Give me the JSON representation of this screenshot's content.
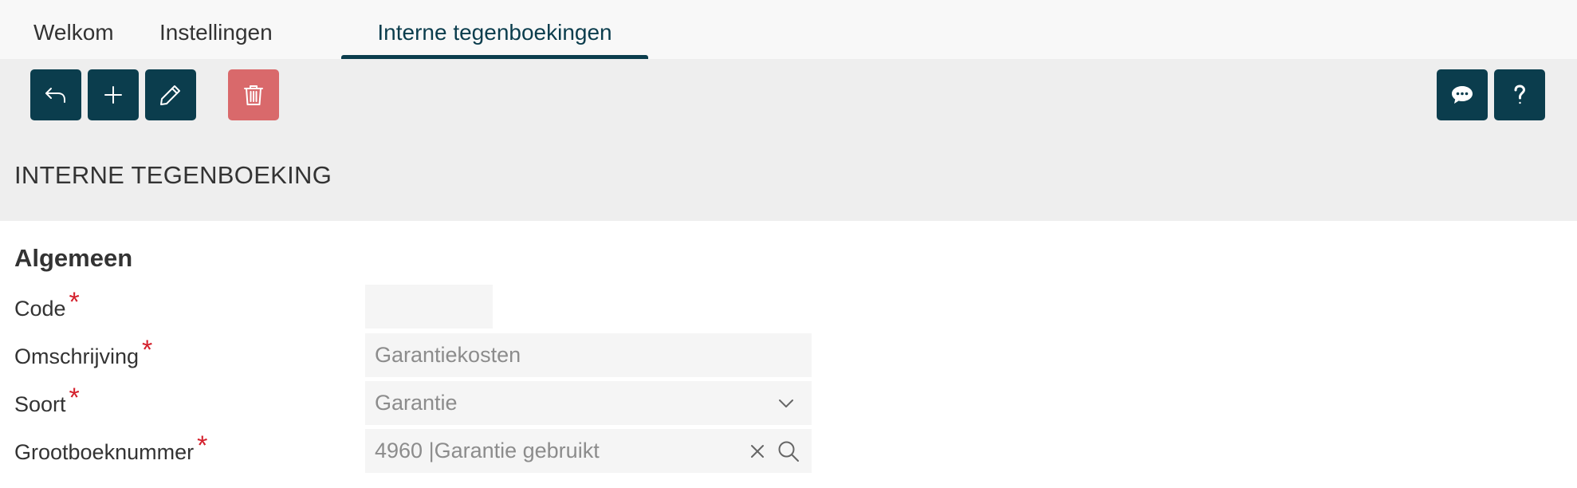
{
  "tabs": [
    {
      "label": "Welkom"
    },
    {
      "label": "Instellingen"
    },
    {
      "label": "Interne tegenboekingen",
      "active": true
    }
  ],
  "toolbar": {
    "buttons": [
      {
        "name": "back",
        "icon": "undo-arrow-icon"
      },
      {
        "name": "add",
        "icon": "plus-icon"
      },
      {
        "name": "edit",
        "icon": "pencil-icon"
      },
      {
        "name": "delete",
        "icon": "trash-icon"
      },
      {
        "name": "comment",
        "icon": "chat-bubble-icon"
      },
      {
        "name": "help",
        "icon": "question-mark-icon"
      }
    ]
  },
  "page": {
    "title": "INTERNE TEGENBOEKING"
  },
  "section": {
    "title": "Algemeen"
  },
  "form": {
    "code": {
      "label": "Code",
      "required": "*",
      "value": ""
    },
    "omschrijving": {
      "label": "Omschrijving",
      "required": "*",
      "value": "Garantiekosten"
    },
    "soort": {
      "label": "Soort",
      "required": "*",
      "value": "Garantie"
    },
    "grootboek": {
      "label": "Grootboeknummer",
      "required": "*",
      "value": "4960 |Garantie gebruikt"
    }
  },
  "colors": {
    "primary": "#0b3d4d",
    "danger": "#d9696b",
    "required": "#d4202c",
    "toolbar_bg": "#eeeeee",
    "field_bg": "#f5f5f5"
  }
}
